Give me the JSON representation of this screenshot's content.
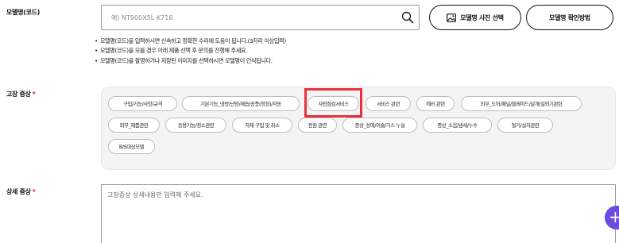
{
  "model": {
    "label": "모델명(코드)",
    "placeholder": "예) NT900X5L-K716",
    "photo_button": "모델명 사진 선택",
    "check_button": "모델명 확인방법",
    "hints": [
      "모델명(코드)을 입력하시면 신속하고 정확한 수리에 도움이 됩니다.(3자리 이상입력)",
      "모델명(코드)을 모를 경우 아래 제품 선택 후 문의를 진행해 주세요.",
      "모델명(코드)을 촬영하거나 저장된 이미지를 선택하시면 모델명이 인식됩니다."
    ]
  },
  "symptom": {
    "label": "고장 증상",
    "required_mark": "*",
    "chips": [
      "구입/기능/사양/규격",
      "기본기능_냉방/난방/제습/송풍(청정)/자동",
      "사전점검서비스",
      "서비스 관련",
      "에러 관련",
      "외부_도어/패널/블레이드/날개/실외기관련",
      "외부_제품관련",
      "응용기능/청소관련",
      "자재 구입 및 취소",
      "전원 관련",
      "증상_성에/이슬/가스 누설",
      "증상_소음/냄새/누수",
      "철거/설치관련",
      "B/S대상모델"
    ],
    "highlighted": "사전점검서비스"
  },
  "detail": {
    "label": "상세 증상",
    "required_mark": "*",
    "placeholder": "고장증상 상세내용만 입력해 주세요."
  },
  "fab": {
    "icon": "plus-icon",
    "color": "#6c4ce0"
  },
  "colors": {
    "required": "#e5173b",
    "highlight": "#e8313f"
  }
}
